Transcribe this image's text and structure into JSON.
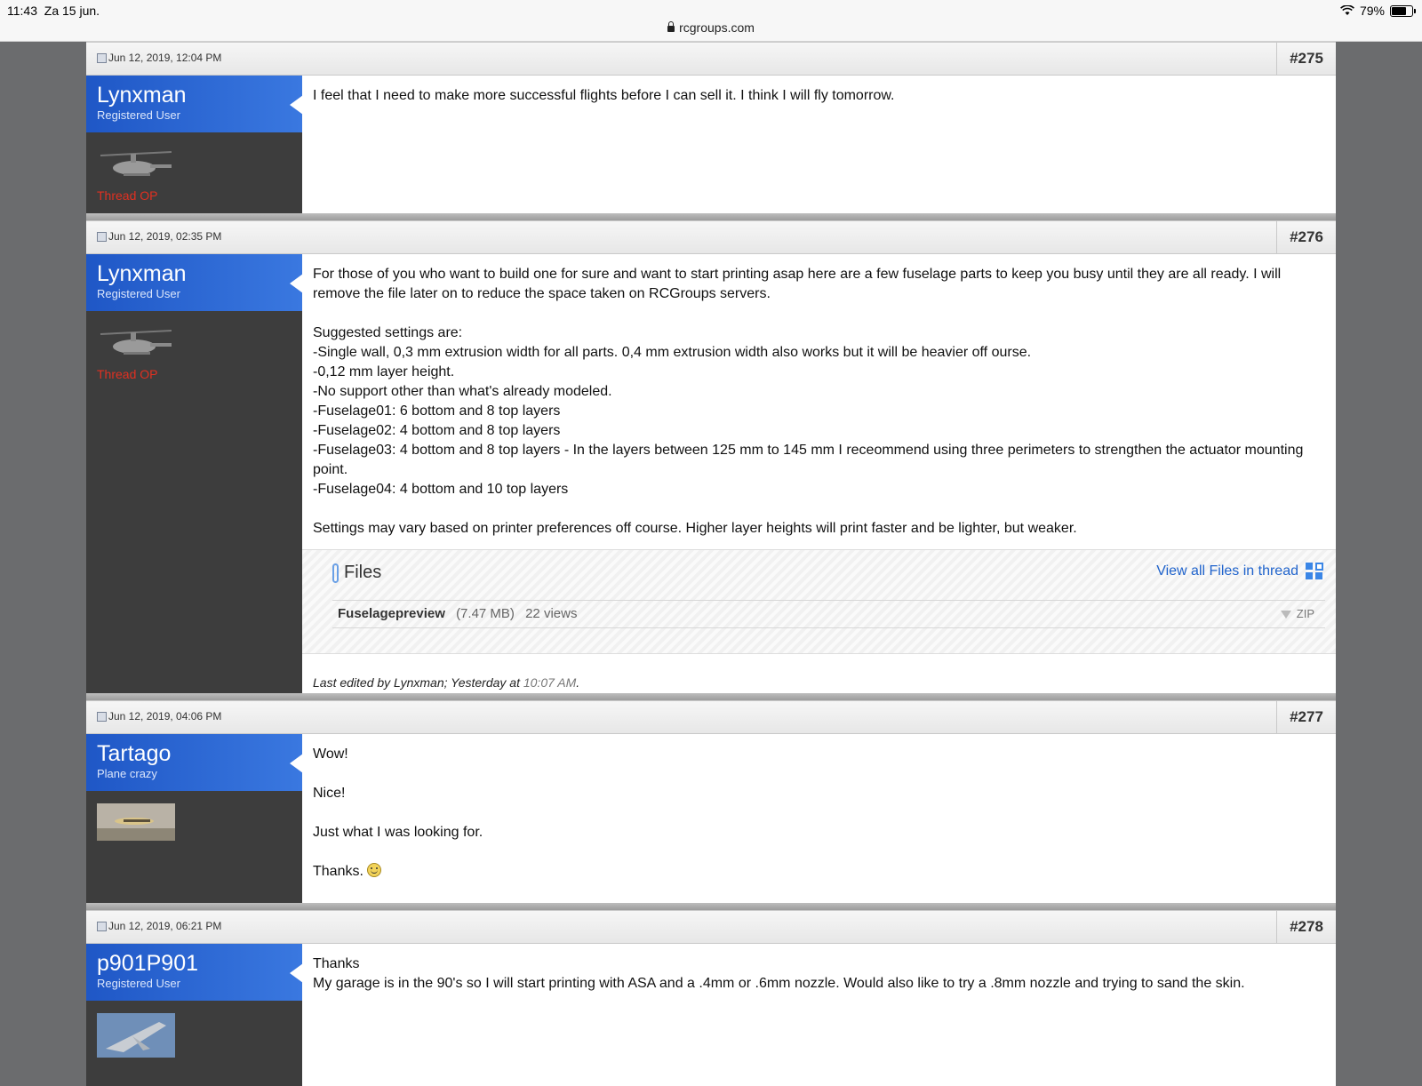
{
  "status_bar": {
    "time": "11:43",
    "date": "Za 15 jun.",
    "battery": "79%",
    "battery_level": 0.79
  },
  "browser": {
    "url": "rcgroups.com"
  },
  "posts": [
    {
      "date": "Jun 12, 2019, 12:04 PM",
      "number": "#275",
      "username": "Lynxman",
      "user_title": "Registered User",
      "badge": "Thread OP",
      "lines": [
        "I feel that I need to make more successful flights before I can sell it. I think I will fly tomorrow."
      ]
    },
    {
      "date": "Jun 12, 2019, 02:35 PM",
      "number": "#276",
      "username": "Lynxman",
      "user_title": "Registered User",
      "badge": "Thread OP",
      "lines": [
        "For those of you who want to build one for sure and want to start printing asap here are a few fuselage parts to keep you busy until they are all ready. I will remove the file later on to reduce the space taken on RCGroups servers.",
        "",
        "Suggested settings are:",
        "-Single wall, 0,3 mm extrusion width for all parts. 0,4 mm extrusion width also works but it will be heavier off ourse.",
        "-0,12 mm layer height.",
        "-No support other than what's already modeled.",
        "-Fuselage01: 6 bottom and 8 top layers",
        "-Fuselage02: 4 bottom and 8 top layers",
        "-Fuselage03: 4 bottom and 8 top layers - In the layers between 125 mm to 145 mm I receommend using three perimeters to strengthen the actuator mounting point.",
        "-Fuselage04: 4 bottom and 10 top layers",
        "",
        "Settings may vary based on printer preferences off course. Higher layer heights will print faster and be lighter, but weaker."
      ],
      "files": {
        "title": "Files",
        "view_all": "View all Files in thread",
        "file_name": "Fuselagepreview",
        "file_size": "(7.47 MB)",
        "file_views": "22 views",
        "file_type": "ZIP"
      },
      "edited": {
        "text": "Last edited by Lynxman; Yesterday at",
        "time": "10:07 AM",
        "end": "."
      }
    },
    {
      "date": "Jun 12, 2019, 04:06 PM",
      "number": "#277",
      "username": "Tartago",
      "user_title": "Plane crazy",
      "lines": [
        "Wow!",
        "",
        "Nice!",
        "",
        "Just what I was looking for.",
        "",
        "Thanks."
      ]
    },
    {
      "date": "Jun 12, 2019, 06:21 PM",
      "number": "#278",
      "username": "p901P901",
      "user_title": "Registered User",
      "lines": [
        "Thanks",
        "My garage is in the 90's so I will start printing with ASA and a .4mm or .6mm nozzle. Would also like to try a .8mm nozzle and trying to sand the skin."
      ]
    }
  ]
}
